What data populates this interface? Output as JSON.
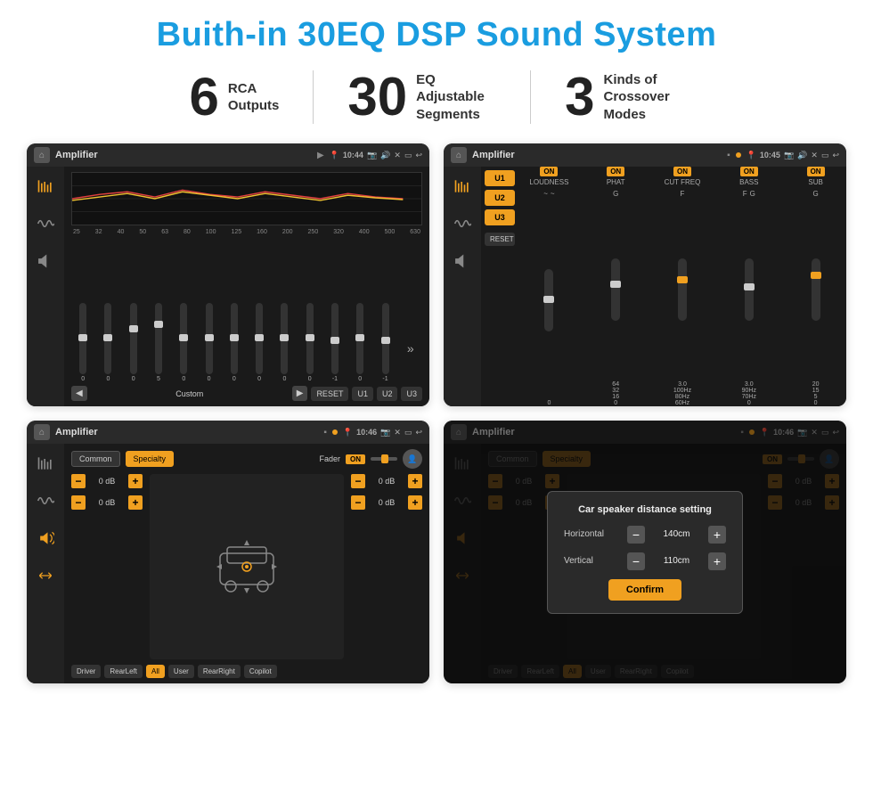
{
  "page": {
    "main_title": "Buith-in 30EQ DSP Sound System",
    "stats": [
      {
        "number": "6",
        "label": "RCA\nOutputs"
      },
      {
        "number": "30",
        "label": "EQ Adjustable\nSegments"
      },
      {
        "number": "3",
        "label": "Kinds of\nCrossover Modes"
      }
    ],
    "screens": [
      {
        "id": "screen1",
        "status_bar": {
          "title": "Amplifier",
          "time": "10:44"
        },
        "type": "eq"
      },
      {
        "id": "screen2",
        "status_bar": {
          "title": "Amplifier",
          "time": "10:45"
        },
        "type": "crossover"
      },
      {
        "id": "screen3",
        "status_bar": {
          "title": "Amplifier",
          "time": "10:46"
        },
        "type": "fader"
      },
      {
        "id": "screen4",
        "status_bar": {
          "title": "Amplifier",
          "time": "10:46"
        },
        "type": "fader-dialog"
      }
    ],
    "eq": {
      "freq_labels": [
        "25",
        "32",
        "40",
        "50",
        "63",
        "80",
        "100",
        "125",
        "160",
        "200",
        "250",
        "320",
        "400",
        "500",
        "630"
      ],
      "values": [
        "0",
        "0",
        "0",
        "5",
        "0",
        "0",
        "0",
        "0",
        "0",
        "0",
        "-1",
        "0",
        "-1"
      ],
      "custom_label": "Custom",
      "reset_label": "RESET",
      "presets": [
        "U1",
        "U2",
        "U3"
      ]
    },
    "crossover": {
      "presets": [
        "U1",
        "U2",
        "U3"
      ],
      "controls": [
        {
          "on": true,
          "label": "LOUDNESS"
        },
        {
          "on": true,
          "label": "PHAT"
        },
        {
          "on": true,
          "label": "CUT FREQ"
        },
        {
          "on": true,
          "label": "BASS"
        },
        {
          "on": true,
          "label": "SUB"
        }
      ],
      "reset_label": "RESET"
    },
    "fader": {
      "tabs": [
        "Common",
        "Specialty"
      ],
      "active_tab": "Specialty",
      "fader_label": "Fader",
      "on_label": "ON",
      "db_values": [
        "0 dB",
        "0 dB",
        "0 dB",
        "0 dB"
      ],
      "buttons": [
        "Driver",
        "RearLeft",
        "All",
        "User",
        "RearRight",
        "Copilot"
      ]
    },
    "dialog": {
      "title": "Car speaker distance setting",
      "horizontal_label": "Horizontal",
      "horizontal_value": "140cm",
      "vertical_label": "Vertical",
      "vertical_value": "110cm",
      "confirm_label": "Confirm"
    }
  }
}
